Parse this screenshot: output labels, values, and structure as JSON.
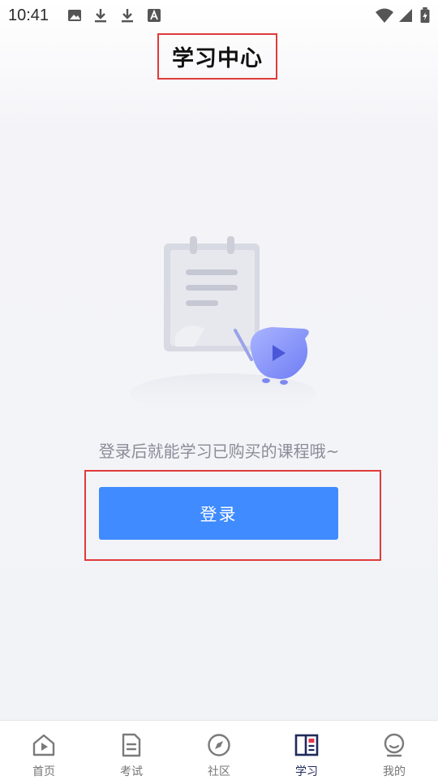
{
  "status_bar": {
    "time": "10:41",
    "notification_icons": [
      "image-icon",
      "download-icon",
      "download-icon",
      "a-icon"
    ],
    "system_icons": [
      "wifi-icon",
      "signal-icon",
      "battery-icon"
    ]
  },
  "header": {
    "title": "学习中心"
  },
  "empty_state": {
    "illustration": "notebook-mascot-illustration",
    "message": "登录后就能学习已购买的课程哦~"
  },
  "login_button": {
    "label": "登录",
    "color": "#3f8bff"
  },
  "bottom_nav": {
    "items": [
      {
        "label": "首页",
        "icon": "home-icon"
      },
      {
        "label": "考试",
        "icon": "exam-icon"
      },
      {
        "label": "社区",
        "icon": "compass-icon"
      },
      {
        "label": "学习",
        "icon": "study-icon",
        "active": true
      },
      {
        "label": "我的",
        "icon": "profile-icon"
      }
    ],
    "active_color": "#1f2a5a",
    "inactive_color": "#757575"
  },
  "highlight_color": "#e03a3a"
}
